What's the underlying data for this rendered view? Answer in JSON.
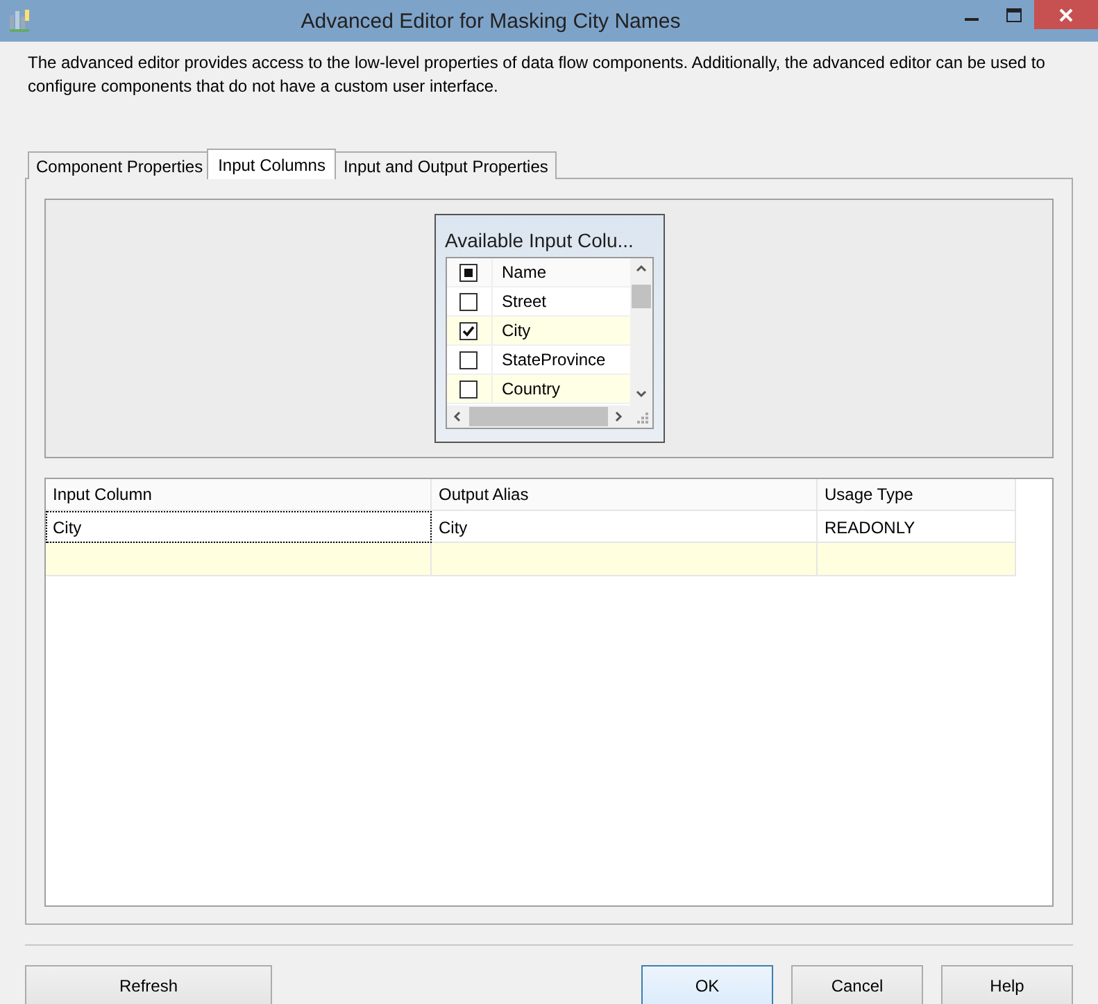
{
  "window": {
    "title": "Advanced Editor for Masking City Names"
  },
  "description": "The advanced editor provides access to the low-level properties of data flow components. Additionally, the advanced editor can be used to configure components that do not have a custom user interface.",
  "tabs": [
    {
      "label": "Component Properties",
      "selected": false
    },
    {
      "label": "Input Columns",
      "selected": true
    },
    {
      "label": "Input and Output Properties",
      "selected": false
    }
  ],
  "available_columns": {
    "title": "Available Input Colu...",
    "header": {
      "label": "Name",
      "indeterminate": true
    },
    "items": [
      {
        "name": "Street",
        "checked": false
      },
      {
        "name": "City",
        "checked": true
      },
      {
        "name": "StateProvince",
        "checked": false
      },
      {
        "name": "Country",
        "checked": false
      }
    ]
  },
  "grid": {
    "columns": [
      "Input Column",
      "Output Alias",
      "Usage Type"
    ],
    "rows": [
      {
        "cells": [
          {
            "text": "City",
            "focused": true
          },
          {
            "text": "City",
            "focused": false
          },
          {
            "text": "READONLY",
            "focused": false
          }
        ]
      }
    ],
    "new_row": true
  },
  "buttons": [
    {
      "label": "Refresh",
      "kind": "left",
      "default": false
    },
    {
      "label": "OK",
      "kind": "right",
      "default": true
    },
    {
      "label": "Cancel",
      "kind": "right",
      "default": false
    },
    {
      "label": "Help",
      "kind": "right",
      "default": false
    }
  ]
}
